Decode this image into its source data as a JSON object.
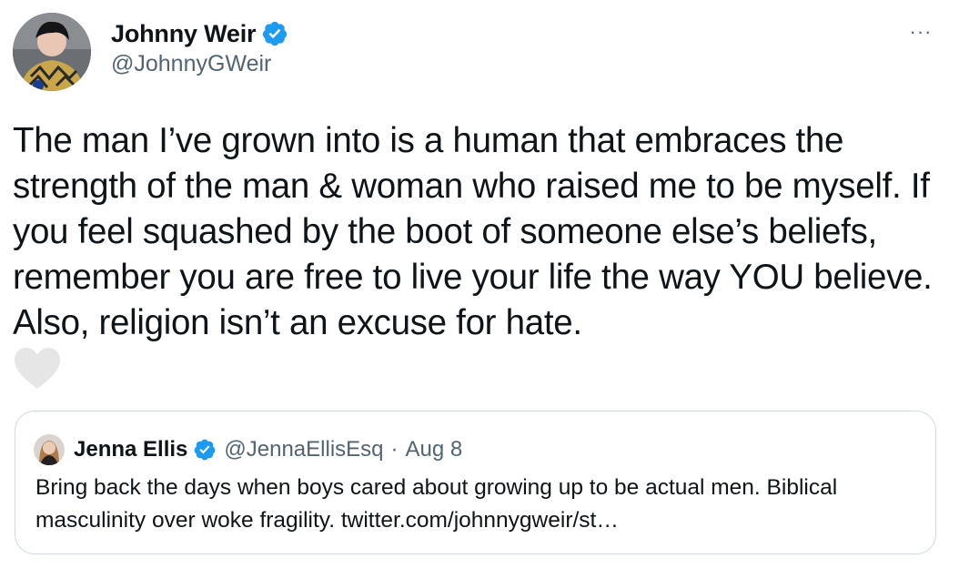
{
  "tweet": {
    "author": {
      "display_name": "Johnny Weir",
      "handle": "@JohnnyGWeir",
      "verified": true
    },
    "text": "The man I’ve grown into is a human that embraces the strength of the man & woman who raised me to be myself. If you feel squashed by the boot of someone else’s beliefs, remember you are free to live your life the way YOU believe. Also, religion isn’t an excuse for hate.",
    "more_label": "···",
    "icons": {
      "verified": "verified-badge-icon",
      "heart": "heart-icon",
      "more": "more-options-icon"
    },
    "colors": {
      "verified_blue": "#1d9bf0",
      "secondary_text": "#536471",
      "heart_gray": "#e6e6e6",
      "card_border": "#cfd9de"
    }
  },
  "quote": {
    "author": {
      "display_name": "Jenna Ellis",
      "handle": "@JennaEllisEsq",
      "verified": true
    },
    "separator": "·",
    "date": "Aug 8",
    "text": "Bring back the days when boys cared about growing up to be actual men. Biblical masculinity over woke fragility. twitter.com/johnnygweir/st…"
  }
}
